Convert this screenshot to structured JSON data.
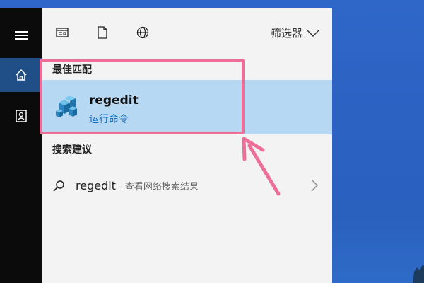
{
  "toolbar": {
    "icons": [
      "documents-icon",
      "file-icon",
      "globe-icon"
    ],
    "filter_label": "筛选器"
  },
  "sidebar": {
    "items": [
      {
        "icon": "hamburger-menu-icon"
      },
      {
        "icon": "home-icon",
        "active": true
      },
      {
        "icon": "user-account-icon"
      }
    ]
  },
  "best_match": {
    "heading": "最佳匹配",
    "title": "regedit",
    "subtitle": "运行命令",
    "icon": "registry-editor-icon"
  },
  "suggestions": {
    "heading": "搜索建议",
    "items": [
      {
        "query": "regedit",
        "separator": " - ",
        "hint": "查看网络搜索结果",
        "icon": "search-icon"
      }
    ]
  },
  "colors": {
    "rail": "#0b0b0b",
    "rail_active": "#1f4f86",
    "panel": "#f3f3f3",
    "highlight_row": "#b6d8f2",
    "link_blue": "#1a6fc2",
    "annotation_pink": "#ee6e9a",
    "desktop": "#2c62c2"
  }
}
